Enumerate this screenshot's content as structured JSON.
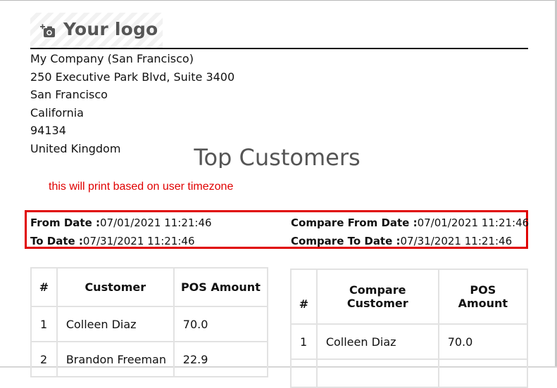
{
  "logo": {
    "text": "Your logo",
    "icon": "camera-add-icon"
  },
  "company": {
    "lines": [
      "My Company (San Francisco)",
      "250 Executive Park Blvd, Suite 3400",
      "San Francisco",
      "California",
      "94134",
      "United Kingdom"
    ]
  },
  "report": {
    "title": "Top Customers",
    "timezone_note": "this will print based on user timezone"
  },
  "dates": {
    "from_label": "From Date :",
    "from_value": "07/01/2021 11:21:46",
    "to_label": "To Date :",
    "to_value": "07/31/2021 11:21:46",
    "compare_from_label": "Compare From Date :",
    "compare_from_value": "07/01/2021 11:21:46",
    "compare_to_label": "Compare To Date :",
    "compare_to_value": "07/31/2021 11:21:46"
  },
  "colors": {
    "highlight_border": "#e00000",
    "note_text": "#e00000"
  },
  "table_main": {
    "headers": {
      "num": "#",
      "customer": "Customer",
      "amount": "POS Amount"
    },
    "rows": [
      {
        "num": "1",
        "customer": "Colleen Diaz",
        "amount": "70.0"
      },
      {
        "num": "2",
        "customer": "Brandon Freeman",
        "amount": "22.9"
      }
    ]
  },
  "table_compare": {
    "headers": {
      "num": "#",
      "customer_l1": "Compare",
      "customer_l2": "Customer",
      "amount_l1": "POS",
      "amount_l2": "Amount"
    },
    "rows": [
      {
        "num": "1",
        "customer": "Colleen Diaz",
        "amount": "70.0"
      }
    ]
  }
}
